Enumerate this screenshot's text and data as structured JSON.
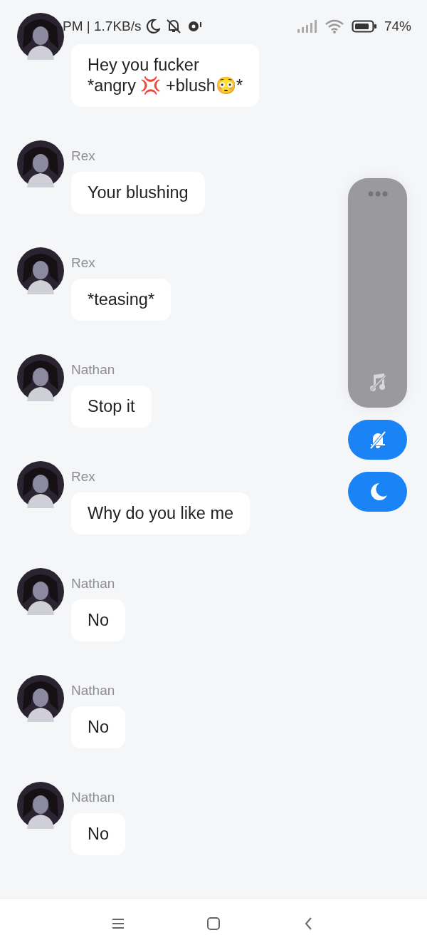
{
  "status_bar": {
    "info": "PM | 1.7KB/s",
    "battery": "74%"
  },
  "volume_panel": {
    "level": 0
  },
  "messages": [
    {
      "text": "Hey you fucker\n*angry 💢 +blush😳*"
    },
    {
      "sender": "Rex",
      "text": "Your blushing"
    },
    {
      "sender": "Rex",
      "text": "*teasing*"
    },
    {
      "sender": "Nathan",
      "text": "Stop it"
    },
    {
      "sender": "Rex",
      "text": "Why do you like me"
    },
    {
      "sender": "Nathan",
      "text": "No"
    },
    {
      "sender": "Nathan",
      "text": "No"
    },
    {
      "sender": "Nathan",
      "text": "No"
    }
  ]
}
